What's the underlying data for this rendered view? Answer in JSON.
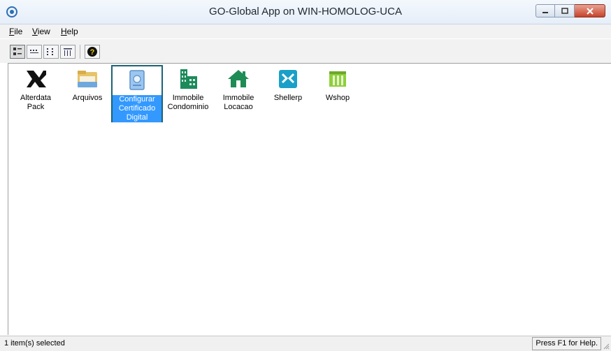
{
  "window": {
    "title": "GO-Global App on WIN-HOMOLOG-UCA"
  },
  "menu": [
    {
      "label": "File",
      "accel": "F",
      "rest": "ile"
    },
    {
      "label": "View",
      "accel": "V",
      "rest": "iew"
    },
    {
      "label": "Help",
      "accel": "H",
      "rest": "elp"
    }
  ],
  "toolbar": {
    "buttons": [
      "large-icons-view",
      "small-icons-view",
      "list-view",
      "details-view",
      "help"
    ]
  },
  "apps": [
    {
      "line1": "Alterdata",
      "line2": "Pack",
      "line3": "",
      "icon": "alterdata-icon",
      "color": "#111111"
    },
    {
      "line1": "Arquivos",
      "line2": "",
      "line3": "",
      "icon": "folder-icon",
      "color": "#e8c36a"
    },
    {
      "line1": "Configurar",
      "line2": "Certificado",
      "line3": "Digital",
      "icon": "certificate-icon",
      "color": "#6da6e0",
      "selected": true
    },
    {
      "line1": "Immobile",
      "line2": "Condominio",
      "line3": "",
      "icon": "building-icon",
      "color": "#1c8a5a"
    },
    {
      "line1": "Immobile",
      "line2": "Locacao",
      "line3": "",
      "icon": "house-icon",
      "color": "#1f8c55"
    },
    {
      "line1": "Shellerp",
      "line2": "",
      "line3": "",
      "icon": "shellerp-icon",
      "color": "#1aa0c8"
    },
    {
      "line1": "Wshop",
      "line2": "",
      "line3": "",
      "icon": "wshop-icon",
      "color": "#8fcf3a"
    }
  ],
  "status": {
    "left": "1 item(s) selected",
    "right": "Press F1 for Help."
  }
}
